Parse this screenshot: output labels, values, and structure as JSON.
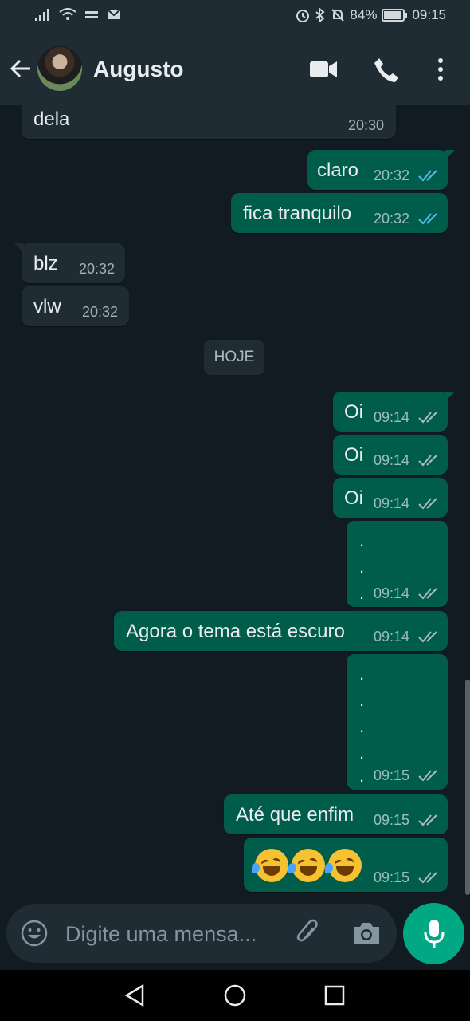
{
  "status_bar": {
    "battery": "84%",
    "time": "09:15"
  },
  "header": {
    "contact_name": "Augusto"
  },
  "chat": {
    "day_label": "HOJE",
    "messages": [
      {
        "dir": "in",
        "text": "dela",
        "time": "20:30"
      },
      {
        "dir": "out",
        "text": "claro",
        "time": "20:32",
        "status": "read"
      },
      {
        "dir": "out",
        "text": "fica tranquilo",
        "time": "20:32",
        "status": "read"
      },
      {
        "dir": "in",
        "text": "blz",
        "time": "20:32"
      },
      {
        "dir": "in",
        "text": "vlw",
        "time": "20:32"
      },
      {
        "dir": "out",
        "text": "Oi",
        "time": "09:14",
        "status": "delivered"
      },
      {
        "dir": "out",
        "text": "Oi",
        "time": "09:14",
        "status": "delivered"
      },
      {
        "dir": "out",
        "text": "Oi",
        "time": "09:14",
        "status": "delivered"
      },
      {
        "dir": "out",
        "lines": [
          ".",
          ".",
          "."
        ],
        "time": "09:14",
        "status": "delivered"
      },
      {
        "dir": "out",
        "text": "Agora o tema está escuro",
        "time": "09:14",
        "status": "delivered"
      },
      {
        "dir": "out",
        "lines": [
          ".",
          ".",
          ".",
          ".",
          "."
        ],
        "time": "09:15",
        "status": "delivered"
      },
      {
        "dir": "out",
        "text": "Até que enfim",
        "time": "09:15",
        "status": "delivered"
      },
      {
        "dir": "out",
        "emoji": "rolling-on-floor-laughing x3",
        "time": "09:15",
        "status": "delivered"
      }
    ]
  },
  "composer": {
    "placeholder": "Digite uma mensa..."
  },
  "colors": {
    "read_ticks": "#53bdeb",
    "accent": "#00a884",
    "out_bubble": "#005c4b",
    "in_bubble": "#1f2c34"
  }
}
